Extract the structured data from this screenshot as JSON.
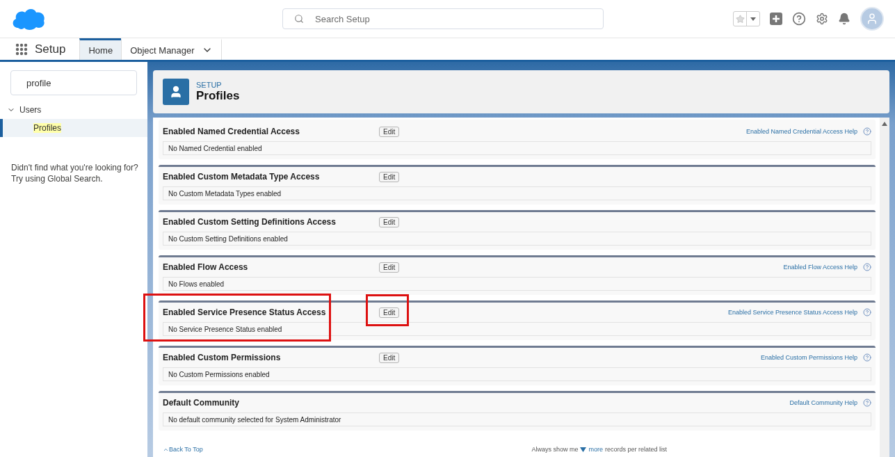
{
  "header": {
    "search": {
      "placeholder": "Search Setup"
    }
  },
  "nav": {
    "app_name": "Setup",
    "tabs": [
      {
        "label": "Home",
        "selected": true,
        "dropdown": false
      },
      {
        "label": "Object Manager",
        "selected": false,
        "dropdown": true
      }
    ]
  },
  "sidebar": {
    "search": {
      "value": "profile"
    },
    "tree": [
      {
        "label": "Users",
        "expanded": true,
        "children": [
          {
            "label": "Profiles",
            "selected": true
          }
        ]
      }
    ],
    "hint": "Didn't find what you're looking for? Try using Global Search."
  },
  "page_header": {
    "eyebrow": "SETUP",
    "title": "Profiles"
  },
  "sections": [
    {
      "title": "Enabled Named Credential Access",
      "edit": "Edit",
      "help": "Enabled Named Credential Access Help",
      "body": "No Named Credential enabled",
      "highlighted": false
    },
    {
      "title": "Enabled Custom Metadata Type Access",
      "edit": "Edit",
      "body": "No Custom Metadata Types enabled",
      "highlighted": false
    },
    {
      "title": "Enabled Custom Setting Definitions Access",
      "edit": "Edit",
      "body": "No Custom Setting Definitions enabled",
      "highlighted": false
    },
    {
      "title": "Enabled Flow Access",
      "edit": "Edit",
      "help": "Enabled Flow Access Help",
      "body": "No Flows enabled",
      "highlighted": false
    },
    {
      "title": "Enabled Service Presence Status Access",
      "edit": "Edit",
      "help": "Enabled Service Presence Status Access Help",
      "body": "No Service Presence Status enabled",
      "highlighted": true
    },
    {
      "title": "Enabled Custom Permissions",
      "edit": "Edit",
      "help": "Enabled Custom Permissions Help",
      "body": "No Custom Permissions enabled",
      "highlighted": false
    },
    {
      "title": "Default Community",
      "help": "Default Community Help",
      "body": "No default community selected for System Administrator",
      "highlighted": false
    }
  ],
  "footer": {
    "back_to_top": "Back To Top",
    "prefix": "Always show me",
    "more": "more",
    "suffix": "records per related list"
  }
}
